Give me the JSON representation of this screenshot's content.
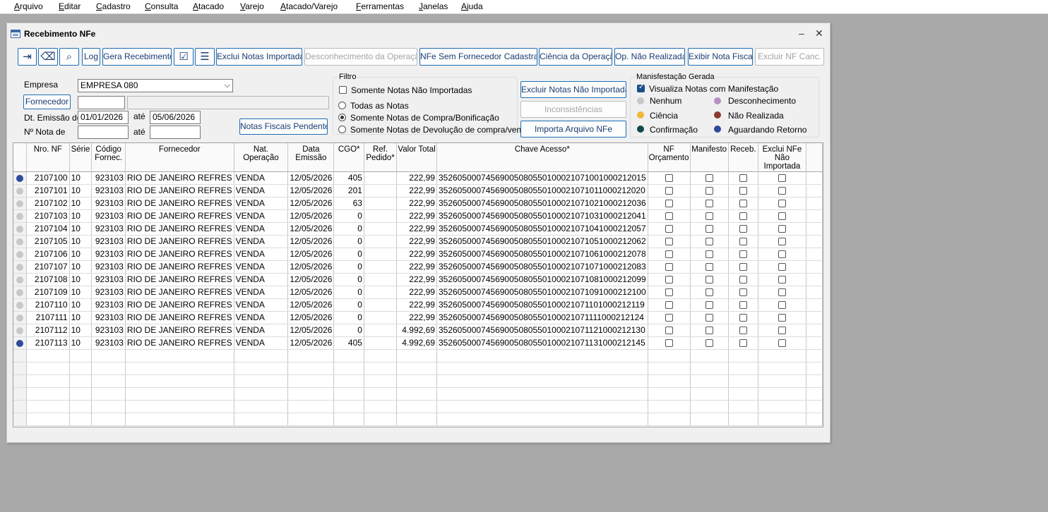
{
  "menu": [
    "Arquivo",
    "Editar",
    "Cadastro",
    "Consulta",
    "Atacado",
    "Varejo",
    "Atacado/Varejo",
    "Ferramentas",
    "Janelas",
    "Ajuda"
  ],
  "window": {
    "title": "Recebimento NFe",
    "minimize": "–",
    "close": "✕"
  },
  "toolbar": {
    "log": "Log",
    "gera_recebimento": "Gera Recebimento",
    "exclui_notas_importadas": "Exclui Notas Importadas",
    "desconhecimento": "Desconhecimento da Operação",
    "nfe_sem_fornecedor": "NFe Sem Fornecedor Cadastrado",
    "ciencia": "Ciência da Operação",
    "op_nao_realizada": "Op. Não Realizada",
    "exibir_nota": "Exibir Nota Fiscal",
    "excluir_nf_canc": "Excluir NF Canc. Se"
  },
  "form": {
    "empresa_label": "Empresa",
    "empresa_value": "EMPRESA 080",
    "fornecedor_button": "Fornecedor",
    "fornecedor_code": "",
    "fornecedor_name": "",
    "dt_emissao_label": "Dt. Emissão de",
    "dt_from": "01/01/2026",
    "ate1": "até",
    "dt_to": "05/06/2026",
    "nota_label": "Nº Nota de",
    "nota_from": "",
    "ate2": "até",
    "nota_to": "",
    "pendentes_button": "Notas Fiscais Pendentes"
  },
  "filtro": {
    "title": "Filtro",
    "somente_nao_importadas": "Somente Notas Não Importadas",
    "todas": "Todas as Notas",
    "compra": "Somente Notas de Compra/Bonificação",
    "devolucao": "Somente Notas de Devolução de compra/venda",
    "selected": "compra"
  },
  "actions": {
    "excluir_nao_importadas": "Excluir Notas Não Importadas",
    "inconsistencias": "Inconsistências",
    "importa_arquivo": "Importa Arquivo NFe"
  },
  "manifestacao": {
    "title": "Manisfestação Gerada",
    "visualiza": "Visualiza Notas com Manifestação",
    "visualiza_checked": true,
    "legend": [
      {
        "label": "Nenhum",
        "color": "#c8c8c8"
      },
      {
        "label": "Desconhecimento",
        "color": "#b88fc4"
      },
      {
        "label": "Ciência",
        "color": "#f0b838"
      },
      {
        "label": "Não Realizada",
        "color": "#8a3a2a"
      },
      {
        "label": "Confirmação",
        "color": "#104a4a"
      },
      {
        "label": "Aguardando Retorno",
        "color": "#2e4a9a"
      }
    ]
  },
  "grid": {
    "headers": [
      "",
      "Nro. NF",
      "Série",
      "Código Fornec.",
      "Fornecedor",
      "Nat. Operação",
      "Data Emissão",
      "CGO*",
      "Ref. Pedido*",
      "Valor Total",
      "Chave Acesso*",
      "NF Orçamento",
      "Manifesto",
      "Receb.",
      "Exclui NFe Não Importada",
      ""
    ],
    "rows": [
      {
        "status": "#2e4a9a",
        "nro": "2107100",
        "serie": "10",
        "codigo": "923103",
        "fornecedor": "RIO DE JANEIRO REFRES",
        "nat": "VENDA",
        "data": "12/05/2026",
        "cgo": "405",
        "ref": "",
        "valor": "222,99",
        "chave": "35260500074569005080550100021071001000212015"
      },
      {
        "status": "#c8c8c8",
        "nro": "2107101",
        "serie": "10",
        "codigo": "923103",
        "fornecedor": "RIO DE JANEIRO REFRES",
        "nat": "VENDA",
        "data": "12/05/2026",
        "cgo": "201",
        "ref": "",
        "valor": "222,99",
        "chave": "35260500074569005080550100021071011000212020"
      },
      {
        "status": "#c8c8c8",
        "nro": "2107102",
        "serie": "10",
        "codigo": "923103",
        "fornecedor": "RIO DE JANEIRO REFRES",
        "nat": "VENDA",
        "data": "12/05/2026",
        "cgo": "63",
        "ref": "",
        "valor": "222,99",
        "chave": "35260500074569005080550100021071021000212036"
      },
      {
        "status": "#c8c8c8",
        "nro": "2107103",
        "serie": "10",
        "codigo": "923103",
        "fornecedor": "RIO DE JANEIRO REFRES",
        "nat": "VENDA",
        "data": "12/05/2026",
        "cgo": "0",
        "ref": "",
        "valor": "222,99",
        "chave": "35260500074569005080550100021071031000212041"
      },
      {
        "status": "#c8c8c8",
        "nro": "2107104",
        "serie": "10",
        "codigo": "923103",
        "fornecedor": "RIO DE JANEIRO REFRES",
        "nat": "VENDA",
        "data": "12/05/2026",
        "cgo": "0",
        "ref": "",
        "valor": "222,99",
        "chave": "35260500074569005080550100021071041000212057"
      },
      {
        "status": "#c8c8c8",
        "nro": "2107105",
        "serie": "10",
        "codigo": "923103",
        "fornecedor": "RIO DE JANEIRO REFRES",
        "nat": "VENDA",
        "data": "12/05/2026",
        "cgo": "0",
        "ref": "",
        "valor": "222,99",
        "chave": "35260500074569005080550100021071051000212062"
      },
      {
        "status": "#c8c8c8",
        "nro": "2107106",
        "serie": "10",
        "codigo": "923103",
        "fornecedor": "RIO DE JANEIRO REFRES",
        "nat": "VENDA",
        "data": "12/05/2026",
        "cgo": "0",
        "ref": "",
        "valor": "222,99",
        "chave": "35260500074569005080550100021071061000212078"
      },
      {
        "status": "#c8c8c8",
        "nro": "2107107",
        "serie": "10",
        "codigo": "923103",
        "fornecedor": "RIO DE JANEIRO REFRES",
        "nat": "VENDA",
        "data": "12/05/2026",
        "cgo": "0",
        "ref": "",
        "valor": "222,99",
        "chave": "35260500074569005080550100021071071000212083"
      },
      {
        "status": "#c8c8c8",
        "nro": "2107108",
        "serie": "10",
        "codigo": "923103",
        "fornecedor": "RIO DE JANEIRO REFRES",
        "nat": "VENDA",
        "data": "12/05/2026",
        "cgo": "0",
        "ref": "",
        "valor": "222,99",
        "chave": "35260500074569005080550100021071081000212099"
      },
      {
        "status": "#c8c8c8",
        "nro": "2107109",
        "serie": "10",
        "codigo": "923103",
        "fornecedor": "RIO DE JANEIRO REFRES",
        "nat": "VENDA",
        "data": "12/05/2026",
        "cgo": "0",
        "ref": "",
        "valor": "222,99",
        "chave": "35260500074569005080550100021071091000212100"
      },
      {
        "status": "#c8c8c8",
        "nro": "2107110",
        "serie": "10",
        "codigo": "923103",
        "fornecedor": "RIO DE JANEIRO REFRES",
        "nat": "VENDA",
        "data": "12/05/2026",
        "cgo": "0",
        "ref": "",
        "valor": "222,99",
        "chave": "35260500074569005080550100021071101000212119"
      },
      {
        "status": "#c8c8c8",
        "nro": "2107111",
        "serie": "10",
        "codigo": "923103",
        "fornecedor": "RIO DE JANEIRO REFRES",
        "nat": "VENDA",
        "data": "12/05/2026",
        "cgo": "0",
        "ref": "",
        "valor": "222,99",
        "chave": "35260500074569005080550100021071111000212124"
      },
      {
        "status": "#c8c8c8",
        "nro": "2107112",
        "serie": "10",
        "codigo": "923103",
        "fornecedor": "RIO DE JANEIRO REFRES",
        "nat": "VENDA",
        "data": "12/05/2026",
        "cgo": "0",
        "ref": "",
        "valor": "4.992,69",
        "chave": "35260500074569005080550100021071121000212130"
      },
      {
        "status": "#2e4a9a",
        "nro": "2107113",
        "serie": "10",
        "codigo": "923103",
        "fornecedor": "RIO DE JANEIRO REFRES",
        "nat": "VENDA",
        "data": "12/05/2026",
        "cgo": "405",
        "ref": "",
        "valor": "4.992,69",
        "chave": "35260500074569005080550100021071131000212145"
      }
    ],
    "empty_rows": 6
  }
}
